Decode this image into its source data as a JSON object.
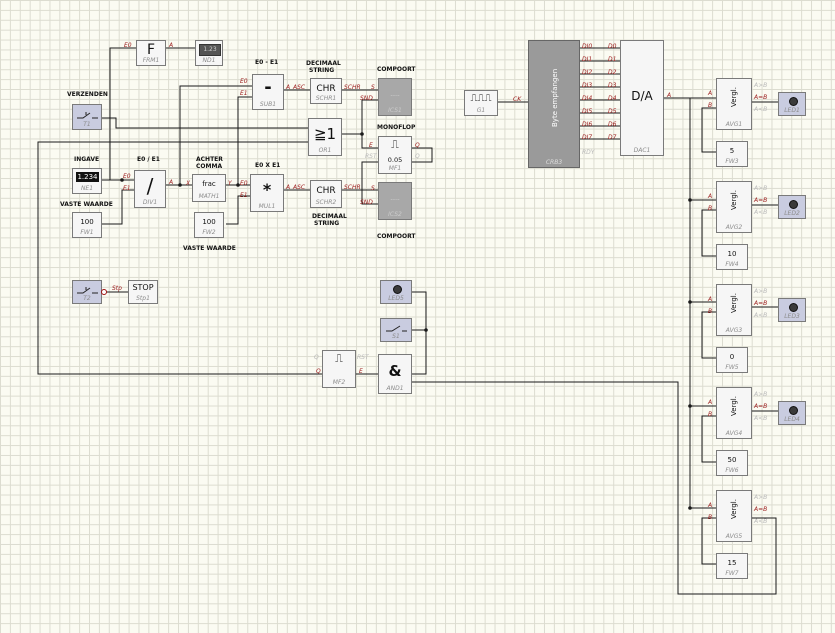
{
  "labels": {
    "verzenden": "VERZENDEN",
    "ingave": "INGAVE",
    "vaste_waarde_1": "VASTE WAARDE",
    "vaste_waarde_2": "VASTE WAARDE",
    "e0_e1": "E0 / E1",
    "e0_minus_e1": "E0 - E1",
    "e0_x_e1": "E0 X E1",
    "decimaal_string_1": "DECIMAAL",
    "decimaal_string_1b": "STRING",
    "decimaal_string_2": "DECIMAAL",
    "decimaal_string_2b": "STRING",
    "achter_comma": "ACHTER",
    "achter_comma_b": "COMMA",
    "compoort_1": "COMPOORT",
    "compoort_2": "COMPOORT",
    "monoflop": "MONOFLOP"
  },
  "blocks": {
    "frm1": {
      "symbol": "F",
      "name": "FRM1",
      "in": "E0",
      "out": "A"
    },
    "nd1": {
      "value": "1.23",
      "name": "ND1"
    },
    "sub1": {
      "symbol": "-",
      "name": "SUB1",
      "in0": "E0",
      "in1": "E1",
      "out": "A",
      "out2": "ASC"
    },
    "schr1": {
      "symbol": "CHR",
      "name": "SCHR1",
      "out": "SCHR"
    },
    "ics1": {
      "name": "ICS1",
      "in0": "S",
      "in1": "SND",
      "content": "....."
    },
    "t1": {
      "name": "T1"
    },
    "or1": {
      "symbol": "≧1",
      "name": "OR1"
    },
    "mf1": {
      "symbol": "⎍",
      "value": "0.05",
      "name": "MF1",
      "in": "E",
      "rst": "RST",
      "q1": "Q",
      "q2": "Q"
    },
    "ne1": {
      "value": "1.234",
      "name": "NE1"
    },
    "div1": {
      "symbol": "/",
      "name": "DIV1",
      "in0": "E0",
      "in1": "E1",
      "out": "A"
    },
    "math1": {
      "symbol": "frac",
      "name": "MATH1",
      "in": "X",
      "out": "Y"
    },
    "mul1": {
      "symbol": "*",
      "name": "MUL1",
      "in0": "E0",
      "in1": "E1",
      "out": "A",
      "out2": "ASC"
    },
    "schr2": {
      "symbol": "CHR",
      "name": "SCHR2",
      "out": "SCHR"
    },
    "ics2": {
      "name": "ICS2",
      "in0": "S",
      "in1": "SND",
      "content": "....."
    },
    "fw1": {
      "value": "100",
      "name": "FW1"
    },
    "fw2": {
      "value": "100",
      "name": "FW2"
    },
    "t2": {
      "name": "T2",
      "out": "Stp"
    },
    "stp1": {
      "symbol": "STOP",
      "name": "Stp1",
      "in": "Stp"
    },
    "led5": {
      "name": "LED5"
    },
    "s1": {
      "name": "S1"
    },
    "and1": {
      "symbol": "&",
      "name": "AND1"
    },
    "mf2": {
      "symbol": "⎍",
      "name": "MF2",
      "q": "Q",
      "rst": "RST",
      "e": "E",
      "qb": "Q"
    },
    "g1": {
      "symbol": "⎍⎍⎍",
      "name": "G1",
      "out": "CK"
    },
    "crb3": {
      "title": "Byte empfangen",
      "name": "CRB3",
      "rdy": "RDY",
      "outs": [
        "DI0",
        "DI1",
        "DI2",
        "DI3",
        "DI4",
        "DI5",
        "DI6",
        "DI7"
      ]
    },
    "dac1": {
      "symbol": "D/A",
      "name": "DAC1",
      "out": "A",
      "ins": [
        "D0",
        "D1",
        "D2",
        "D3",
        "D4",
        "D5",
        "D6",
        "D7"
      ]
    },
    "comparators": [
      {
        "name": "AVG1",
        "symbol": "Vergl.",
        "a": "A",
        "b": "B",
        "o1": "A>B",
        "o2": "A=B",
        "o3": "A<B",
        "fw": "5",
        "fw_name": "FW3",
        "led": "LED1"
      },
      {
        "name": "AVG2",
        "symbol": "Vergl.",
        "a": "A",
        "b": "B",
        "o1": "A>B",
        "o2": "A=B",
        "o3": "A<B",
        "fw": "10",
        "fw_name": "FW4",
        "led": "LED2"
      },
      {
        "name": "AVG3",
        "symbol": "Vergl.",
        "a": "A",
        "b": "B",
        "o1": "A>B",
        "o2": "A=B",
        "o3": "A<B",
        "fw": "0",
        "fw_name": "FW5",
        "led": "LED3"
      },
      {
        "name": "AVG4",
        "symbol": "Vergl.",
        "a": "A",
        "b": "B",
        "o1": "A>B",
        "o2": "A=B",
        "o3": "A<B",
        "fw": "50",
        "fw_name": "FW6",
        "led": "LED4"
      },
      {
        "name": "AVG5",
        "symbol": "Vergl.",
        "a": "A",
        "b": "B",
        "o1": "A>B",
        "o2": "A=B",
        "o3": "A<B",
        "fw": "15",
        "fw_name": "FW7",
        "led": ""
      }
    ]
  }
}
